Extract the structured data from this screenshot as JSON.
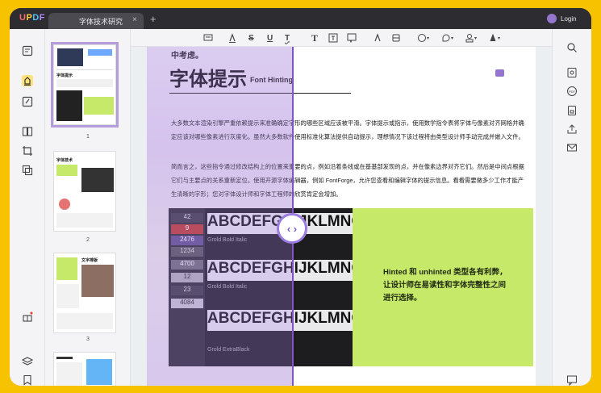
{
  "app": {
    "logo": {
      "u": "U",
      "p": "P",
      "d": "D",
      "f": "F"
    },
    "tab_title": "字体技术研究",
    "tab_close": "×",
    "tab_add": "+",
    "login_label": "Login"
  },
  "left_rail": {
    "icons": [
      "reader-icon",
      "highlighter-icon",
      "edit-icon",
      "organize-icon",
      "crop-icon",
      "convert-icon",
      "gift-icon",
      "layers-icon",
      "bookmark-icon"
    ]
  },
  "thumbnails": {
    "pages": [
      {
        "number": "1",
        "heading": "字体提示",
        "selected": true
      },
      {
        "number": "2",
        "heading": "字体技术",
        "selected": false
      },
      {
        "number": "3",
        "heading": "文字排版",
        "selected": false
      }
    ]
  },
  "toolbar": {
    "tools": [
      "comment-icon",
      "highlight-icon",
      "strikethrough-icon",
      "underline-icon",
      "squiggly-icon",
      "text-icon",
      "textbox-icon",
      "text-callout-icon",
      "pencil-icon",
      "eraser-icon",
      "shape-icon",
      "sticker-icon",
      "stamp-icon",
      "signature-icon"
    ],
    "labels": {
      "s": "S",
      "u": "U",
      "t1": "T",
      "t2": "T"
    }
  },
  "right_rail": {
    "icons": [
      "search-icon",
      "ocr-icon",
      "pdf-a-icon",
      "protect-icon",
      "share-icon",
      "mail-icon",
      "comments-icon"
    ]
  },
  "page": {
    "top_text": "中考虑。",
    "title": "字体提示",
    "subtitle": "Font Hinting",
    "paragraph1": "大多数文本渲染引擎严重依赖提示来准确确定字形的哪些区域应该被平滑。字体提示或指示，使用数学指令表将字体与像素对齐网格并确定应该对哪些像素进行灰度化。虽然大多数软件使用标准化算法提供自动提示，理想情况下该过程将由类型设计师手动完成并嵌入文件。",
    "paragraph2": "简而言之，这些指令通过修改结构上的位置来重要的点，例如沿着条线或在基基部发现的点，并在像素边界对齐它们。然后是中间点根据它们与主要点的关系重新定位。使用开源字体编辑器，例如 FontForge，允许您查看和编辑字体的提示信息。看看需要做多少工作才能产生清晰的字形；您对字体设计师和字体工程师的欣赏肯定会增加。",
    "photo": {
      "rows": [
        "ABCDEFGHIJKLMNO",
        "Grold Bold Italic",
        "ABCDEFGHIJKLMNO",
        "Grold Bold Italic",
        "ABCDEFGHIJKLMNO",
        "Grold ExtraBlack"
      ],
      "numbers": [
        "42",
        "9",
        "2476",
        "1234",
        "4700",
        "12",
        "23",
        "4084"
      ]
    },
    "green_text": "Hinted 和 unhinted 类型各有利弊，让设计师在易读性和字体完整性之间进行选择。",
    "slider_handle": "‹ ›"
  }
}
